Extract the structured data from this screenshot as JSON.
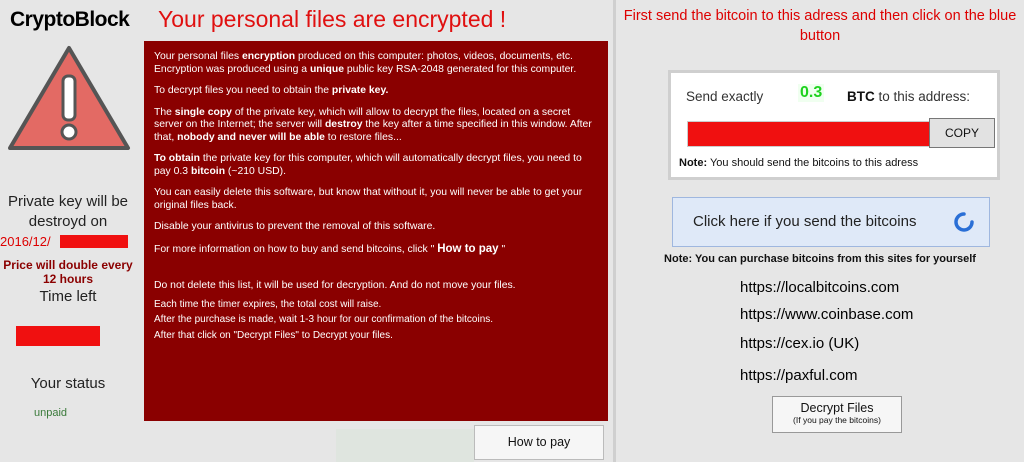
{
  "app": {
    "brand": "CryptoBlock",
    "headline": "Your personal files are encrypted !"
  },
  "left": {
    "private_key_label": "Private key will be destroyd on",
    "date_text": "2016/12/",
    "price_double": "Price will double every 12 hours",
    "time_left_label": "Time left",
    "status_label": "Your status",
    "status_value": "unpaid"
  },
  "message": {
    "p1_a": "Your personal files ",
    "p1_b": "encryption",
    "p1_c": " produced on this computer: photos, videos, documents, etc. Encryption was produced using a ",
    "p1_d": "unique",
    "p1_e": " public key RSA-2048 generated for this computer.",
    "p2_a": "To decrypt files you need to obtain the ",
    "p2_b": "private key.",
    "p3_a": "The ",
    "p3_b": "single copy",
    "p3_c": " of the private key, which will allow to decrypt the files, located on a secret server on the Internet; the server will ",
    "p3_d": "destroy",
    "p3_e": " the key after a time specified in this window. After that, ",
    "p3_f": "nobody and never will be able",
    "p3_g": " to restore files...",
    "p4_a": "To obtain",
    "p4_b": " the private key for this computer, which will automatically decrypt files, you need to pay ",
    "p4_amount": "0.3",
    "p4_c": " ",
    "p4_d": "bitcoin",
    "p4_e": " (~210 USD).",
    "p5": "You can easily delete this software, but know that without it, you will never be able to get your original files back.",
    "p6": "Disable your antivirus to prevent the removal of this software.",
    "p7_a": "For more information on how to buy and send bitcoins, click \" ",
    "p7_link": "How to pay",
    "p7_b": " \"",
    "p8": "Do not delete this list, it will be used for decryption. And do not move your files.",
    "p9": "Each time the timer expires, the total cost will raise.",
    "p10": "After the purchase is made, wait  1-3  hour for our confirmation of the bitcoins.",
    "p11": "After that click on \"Decrypt Files\" to Decrypt your files."
  },
  "howto_button": "How to pay",
  "right": {
    "instruction": "First send the bitcoin to this adress and then click on the blue button",
    "send_exactly": "Send exactly",
    "btc_amount": "0.3",
    "btc_word": "BTC",
    "to_address": " to this address:",
    "copy_label": "COPY",
    "note_prefix": "Note:",
    "note_text": " You should send the bitcoins to this adress",
    "paid_button": "Click here if you send the bitcoins",
    "purchase_note": "Note: You can purchase bitcoins from this sites for yourself",
    "sites": [
      "https://localbitcoins.com",
      "https://www.coinbase.com",
      "https://cex.io (UK)",
      "https://paxful.com"
    ],
    "decrypt_main": "Decrypt Files",
    "decrypt_sub": "(If you pay the bitcoins)"
  },
  "colors": {
    "accent_red": "#e01010",
    "panel_dark_red": "#8a0000",
    "btc_green": "#1ed21e",
    "spinner_blue": "#2a6fd6"
  }
}
